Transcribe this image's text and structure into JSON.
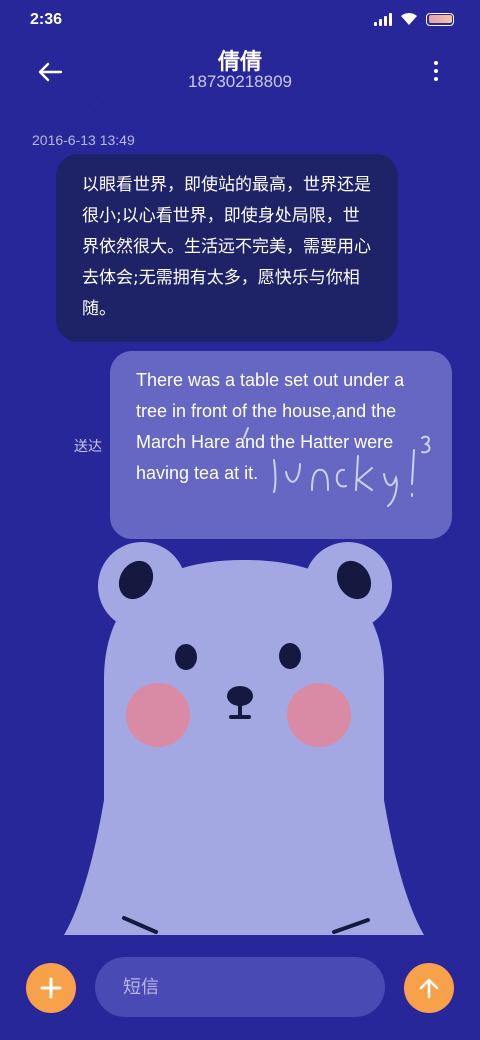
{
  "status_bar": {
    "time": "2:36",
    "icons": [
      "signal-icon",
      "wifi-icon",
      "battery-icon"
    ]
  },
  "header": {
    "contact_name": "倩倩",
    "contact_number": "18730218809",
    "back_icon": "back-arrow-icon",
    "more_icon": "more-vertical-icon"
  },
  "conversation": {
    "timestamp": "2016-6-13 13:49",
    "received_message": "以眼看世界，即使站的最高，世界还是很小;以心看世界，即使身处局限，世界依然很大。生活远不完美，需要用心去体会;无需拥有太多，愿快乐与你相随。",
    "sent_message": "There was a table set out under a tree in front of the house,and the March Hare and the Hatter were having tea at it.",
    "sent_status": "送达"
  },
  "composer": {
    "add_icon": "plus-icon",
    "input_placeholder": "短信",
    "input_value": "",
    "send_icon": "arrow-up-icon"
  },
  "colors": {
    "background": "#27279a",
    "received_bubble": "#1e2266",
    "sent_bubble": "#6567c2",
    "accent": "#f7a14a",
    "bear_body": "#a4a8e2",
    "bear_cheek": "#d98aa4"
  }
}
